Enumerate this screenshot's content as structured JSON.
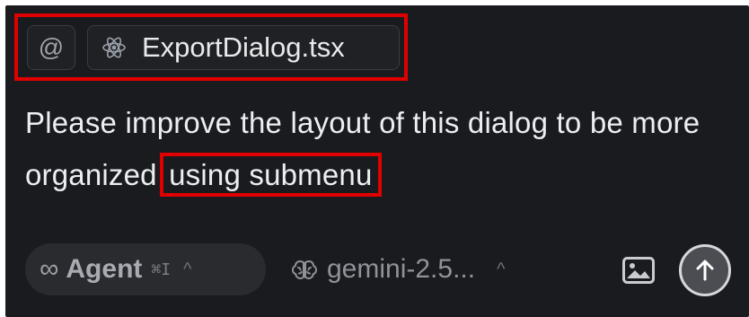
{
  "context": {
    "mention_symbol": "@",
    "file_name": "ExportDialog.tsx",
    "file_icon": "react-icon"
  },
  "message": {
    "text_before": "Please improve the layout of this dialog to be more organized ",
    "highlighted": "using submenu"
  },
  "toolbar": {
    "mode_symbol": "∞",
    "mode_label": "Agent",
    "mode_shortcut": "⌘I",
    "mode_chevron": "^",
    "model_icon": "brain-icon",
    "model_name": "gemini-2.5...",
    "model_chevron": "^",
    "image_icon": "image-icon",
    "send_icon": "arrow-up-icon"
  },
  "colors": {
    "background": "#1a1b1e",
    "highlight_box": "#e10000",
    "text": "#eceef1"
  }
}
